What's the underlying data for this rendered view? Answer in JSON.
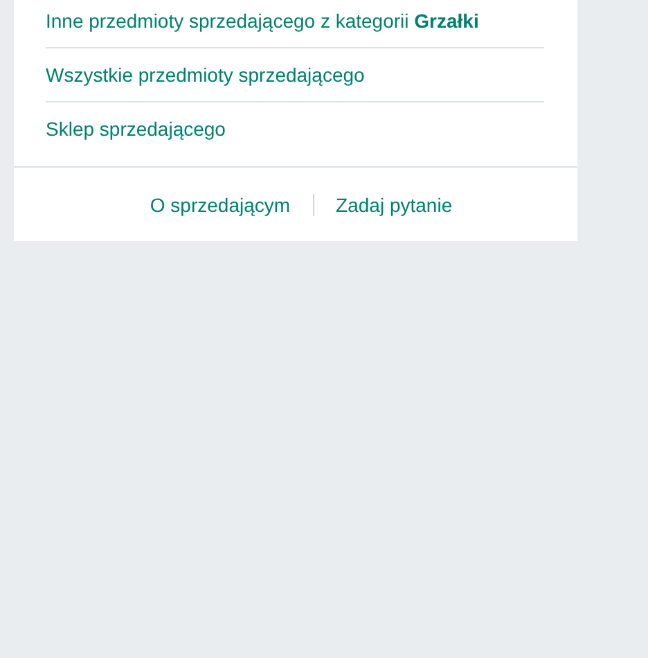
{
  "seller_links": [
    "Inne przedmioty sprzedającego z kategorii **Grzałki**",
    "Wszystkie przedmioty sprzedającego",
    "Sklep sprzedającego"
  ],
  "footer_links": [
    "O sprzedającym",
    "Zadaj pytanie"
  ]
}
